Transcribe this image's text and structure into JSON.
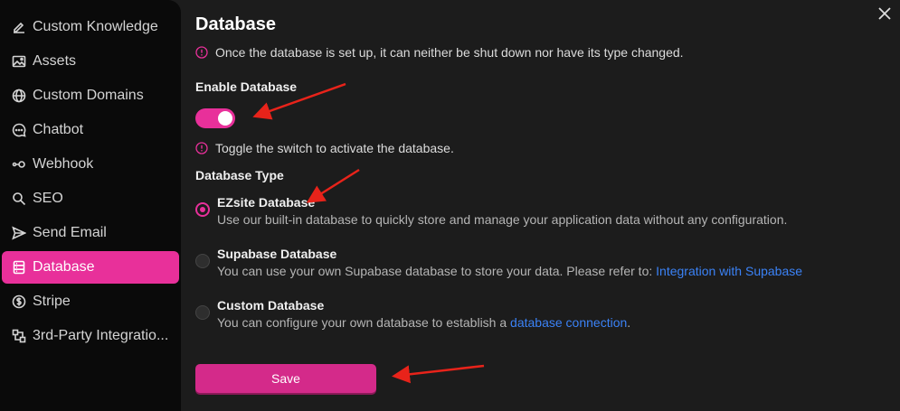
{
  "sidebar": {
    "items": [
      {
        "label": "Custom Knowledge",
        "icon": "pencil-icon"
      },
      {
        "label": "Assets",
        "icon": "image-icon"
      },
      {
        "label": "Custom Domains",
        "icon": "globe-icon"
      },
      {
        "label": "Chatbot",
        "icon": "chat-bubble-icon"
      },
      {
        "label": "Webhook",
        "icon": "webhook-icon"
      },
      {
        "label": "SEO",
        "icon": "search-icon"
      },
      {
        "label": "Send Email",
        "icon": "send-icon"
      },
      {
        "label": "Database",
        "icon": "database-icon",
        "active": true
      },
      {
        "label": "Stripe",
        "icon": "dollar-icon"
      },
      {
        "label": "3rd-Party Integratio...",
        "icon": "integration-icon"
      }
    ]
  },
  "main": {
    "title": "Database",
    "warning": "Once the database is set up, it can neither be shut down nor have its type changed.",
    "enable_label": "Enable Database",
    "enable_on": true,
    "toggle_hint": "Toggle the switch to activate the database.",
    "type_label": "Database Type",
    "options": [
      {
        "title": "EZsite Database",
        "desc": "Use our built-in database to quickly store and manage your application data without any configuration.",
        "checked": true
      },
      {
        "title": "Supabase Database",
        "desc": "You can use your own Supabase database to store your data. Please refer to: ",
        "link": "Integration with Supabase",
        "checked": false
      },
      {
        "title": "Custom Database",
        "desc": "You can configure your own database to establish a ",
        "link": "database connection",
        "suffix": ".",
        "checked": false
      }
    ],
    "save_label": "Save"
  },
  "colors": {
    "accent": "#e8309a",
    "link": "#3b82f6",
    "annotation_arrow": "#e8231a"
  }
}
